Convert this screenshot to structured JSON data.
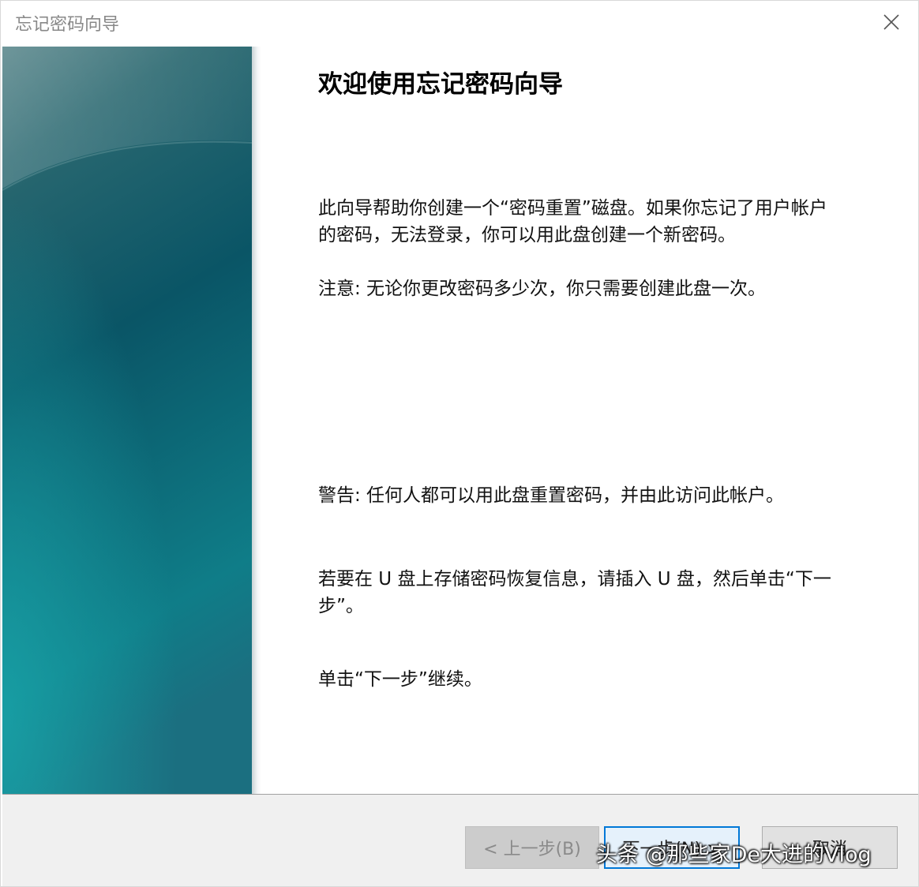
{
  "window": {
    "title": "忘记密码向导"
  },
  "content": {
    "heading": "欢迎使用忘记密码向导",
    "para1": "此向导帮助你创建一个“密码重置”磁盘。如果你忘记了用户帐户的密码，无法登录，你可以用此盘创建一个新密码。",
    "para2": "注意: 无论你更改密码多少次，你只需要创建此盘一次。",
    "para3": "警告: 任何人都可以用此盘重置密码，并由此访问此帐户。",
    "para4": "若要在 U 盘上存储密码恢复信息，请插入 U 盘，然后单击“下一步”。",
    "para5": "单击“下一步”继续。"
  },
  "buttons": {
    "back": "< 上一步(B)",
    "next": "下一步(N) >",
    "cancel": "取消"
  },
  "watermark": {
    "text": "头条 @那些家De大进的Vlog"
  },
  "colors": {
    "side_panel_top": "#3b6e74",
    "side_panel_mid": "#0c5866",
    "side_panel_bottom": "#11878f",
    "primary_button_border": "#0078d7"
  },
  "icons": {
    "close": "close-icon"
  }
}
